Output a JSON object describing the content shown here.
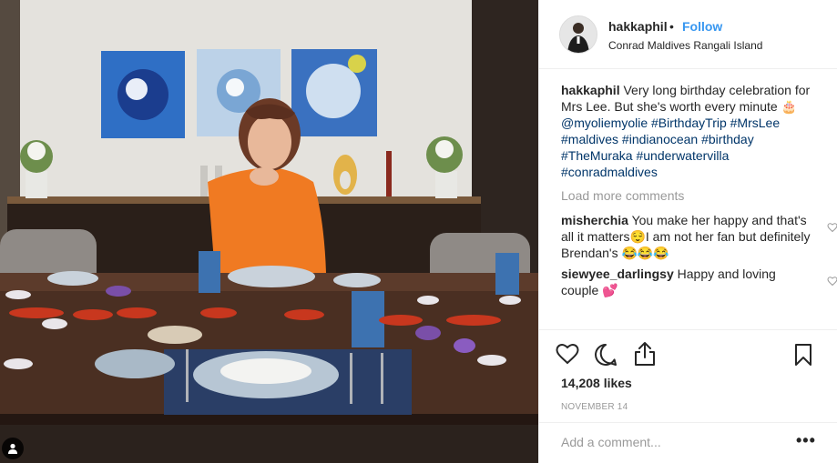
{
  "header": {
    "username": "hakkaphil",
    "separator": "•",
    "follow_label": "Follow",
    "location": "Conrad Maldives Rangali Island"
  },
  "caption": {
    "username": "hakkaphil",
    "text": "Very long birthday celebration for Mrs Lee. But she's worth every minute 🎂",
    "mention": "@myoliemyolie",
    "hashtags": "#BirthdayTrip #MrsLee #maldives #indianocean #birthday #TheMuraka #underwatervilla #conradmaldives"
  },
  "load_more_label": "Load more comments",
  "comments": [
    {
      "username": "misherchia",
      "text": "You make her happy and that's all it matters😌I am not her fan but definitely Brendan's 😂😂😂"
    },
    {
      "username": "siewyee_darlingsy",
      "text": "Happy and loving couple 💕"
    }
  ],
  "likes": "14,208 likes",
  "date": "NOVEMBER 14",
  "add_comment_placeholder": "Add a comment...",
  "more_options": "•••",
  "icons": {
    "like": "heart-icon",
    "comment": "comment-icon",
    "share": "share-icon",
    "save": "bookmark-icon",
    "comment_like": "heart-icon",
    "user_tag": "user-icon"
  },
  "colors": {
    "link": "#3897f0",
    "hashtag": "#003569",
    "muted": "#999999"
  }
}
